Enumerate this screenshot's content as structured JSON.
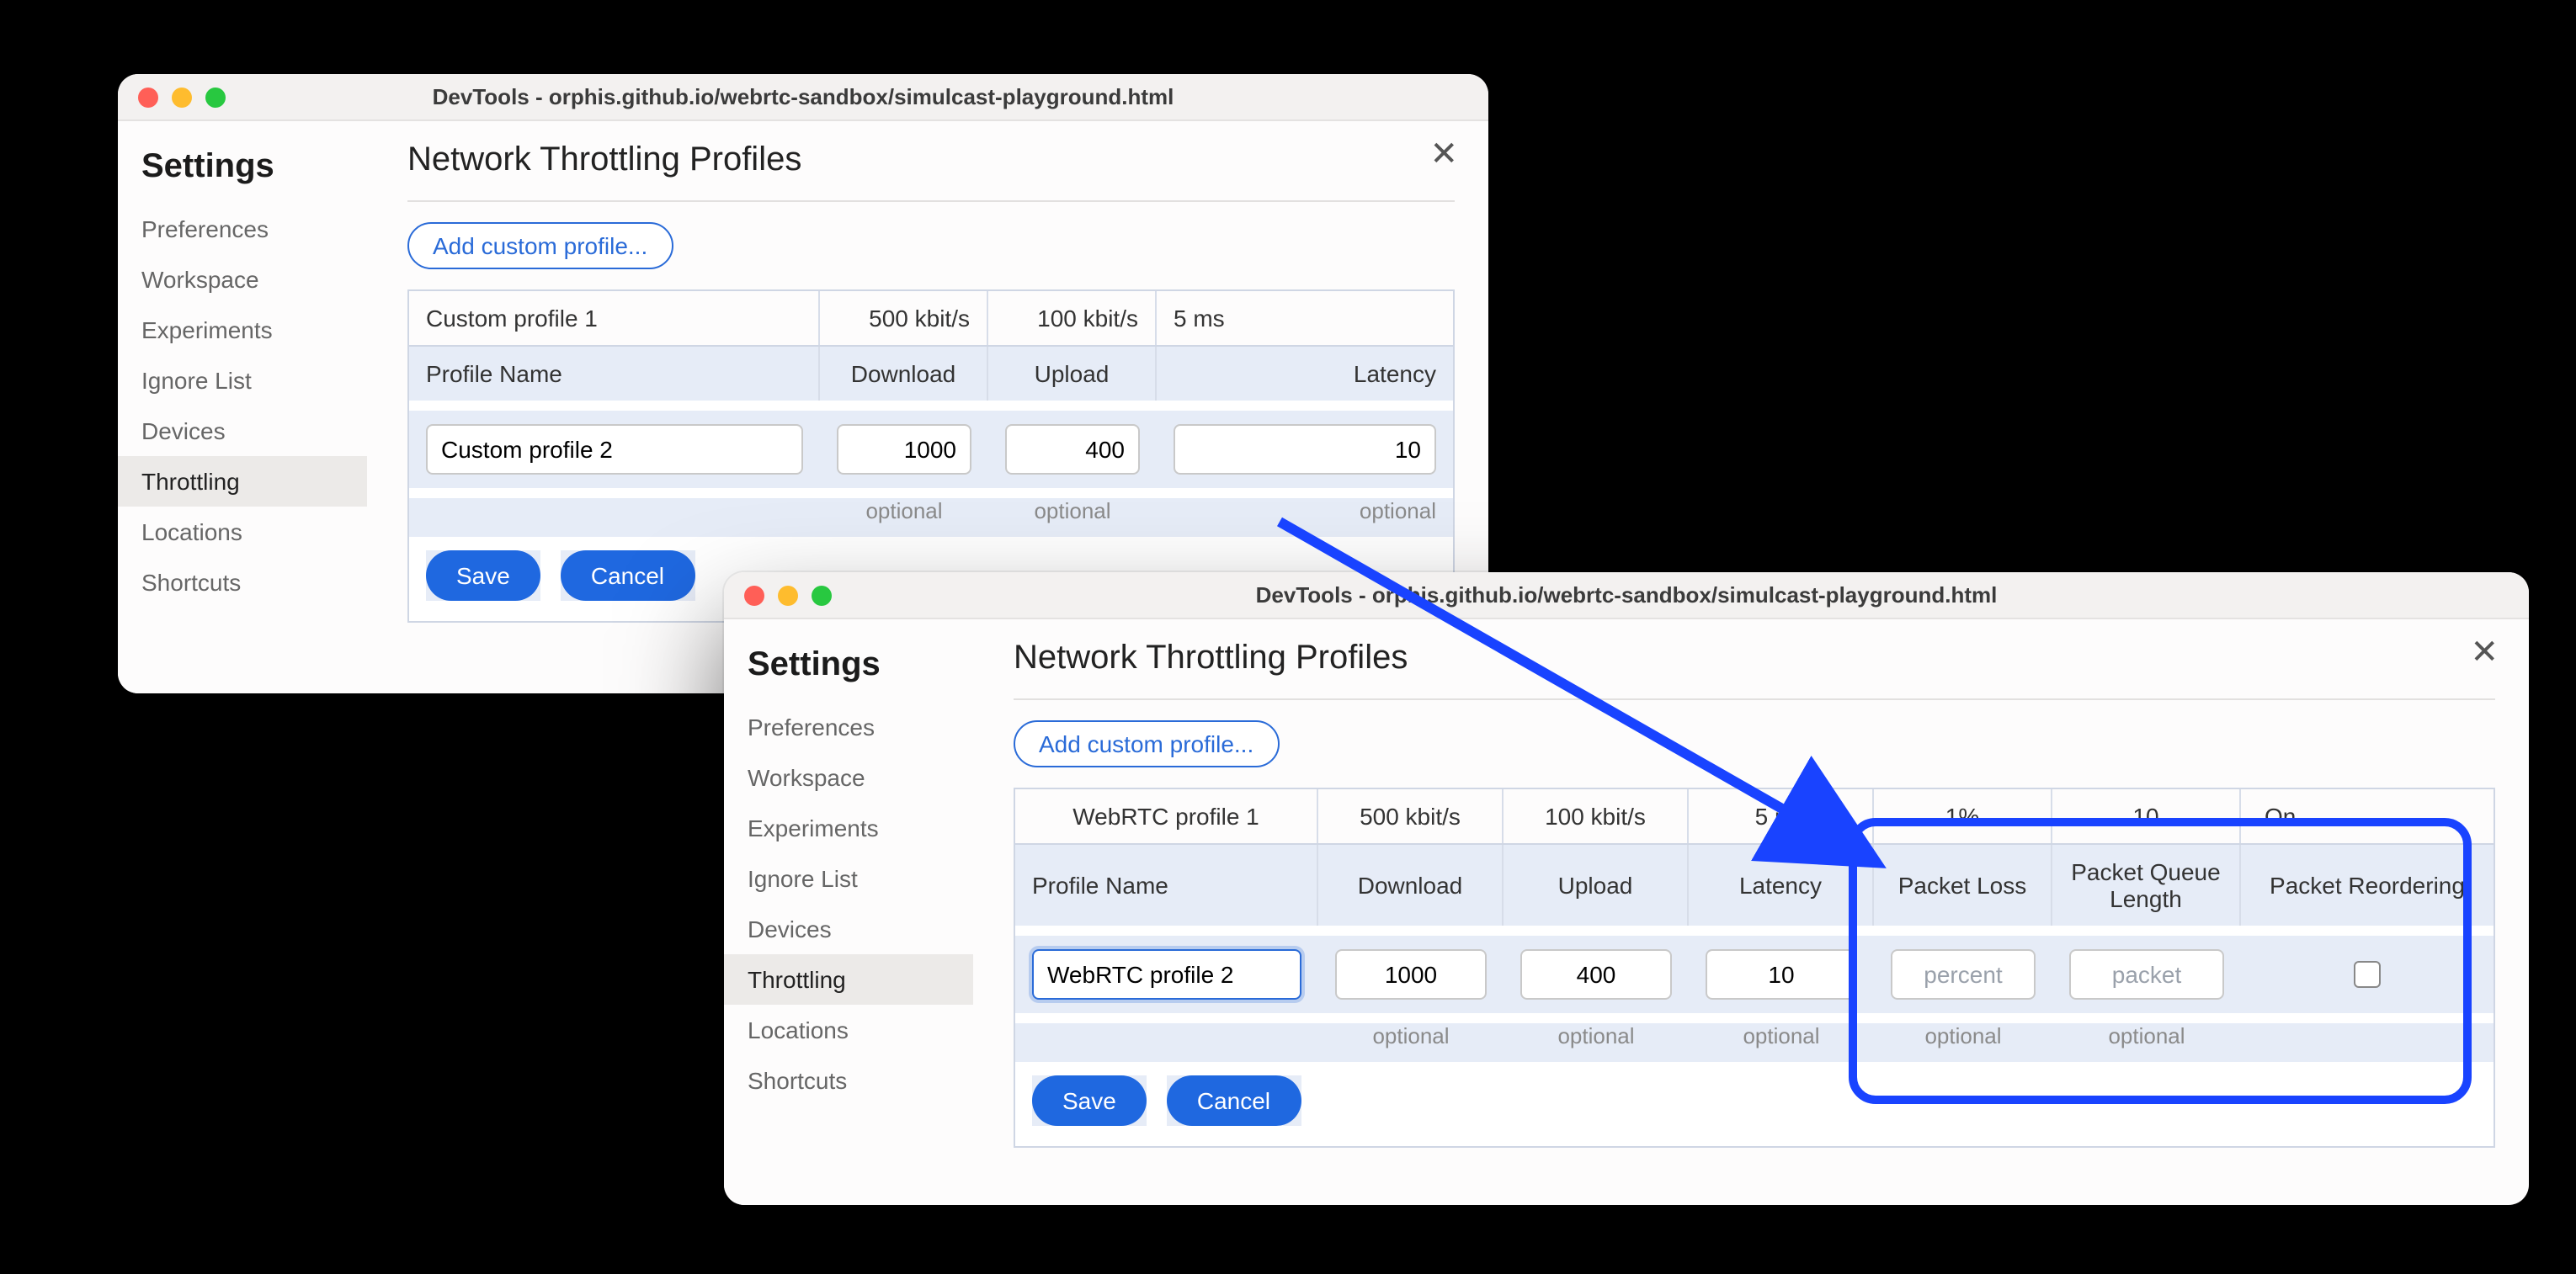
{
  "windows": {
    "old": {
      "title": "DevTools - orphis.github.io/webrtc-sandbox/simulcast-playground.html",
      "sidebar_title": "Settings",
      "sidebar": [
        "Preferences",
        "Workspace",
        "Experiments",
        "Ignore List",
        "Devices",
        "Throttling",
        "Locations",
        "Shortcuts"
      ],
      "active_sidebar_index": 5,
      "heading": "Network Throttling Profiles",
      "add_label": "Add custom profile...",
      "columns": [
        "Profile Name",
        "Download",
        "Upload",
        "Latency"
      ],
      "data_row": {
        "name": "Custom profile 1",
        "download": "500 kbit/s",
        "upload": "100 kbit/s",
        "latency": "5 ms"
      },
      "edit_row": {
        "name": "Custom profile 2",
        "download": "1000",
        "upload": "400",
        "latency": "10"
      },
      "optional_label": "optional",
      "save_label": "Save",
      "cancel_label": "Cancel"
    },
    "new": {
      "title": "DevTools - orphis.github.io/webrtc-sandbox/simulcast-playground.html",
      "sidebar_title": "Settings",
      "sidebar": [
        "Preferences",
        "Workspace",
        "Experiments",
        "Ignore List",
        "Devices",
        "Throttling",
        "Locations",
        "Shortcuts"
      ],
      "active_sidebar_index": 5,
      "heading": "Network Throttling Profiles",
      "add_label": "Add custom profile...",
      "columns": [
        "Profile Name",
        "Download",
        "Upload",
        "Latency",
        "Packet Loss",
        "Packet Queue Length",
        "Packet Reordering"
      ],
      "data_row": {
        "name": "WebRTC profile 1",
        "download": "500 kbit/s",
        "upload": "100 kbit/s",
        "latency": "5 ms",
        "packet_loss": "1%",
        "packet_queue": "10",
        "packet_reorder": "On"
      },
      "edit_row": {
        "name": "WebRTC profile 2",
        "download": "1000",
        "upload": "400",
        "latency": "10",
        "packet_loss_ph": "percent",
        "packet_queue_ph": "packet",
        "packet_reorder_checked": false
      },
      "optional_label": "optional",
      "save_label": "Save",
      "cancel_label": "Cancel"
    }
  }
}
